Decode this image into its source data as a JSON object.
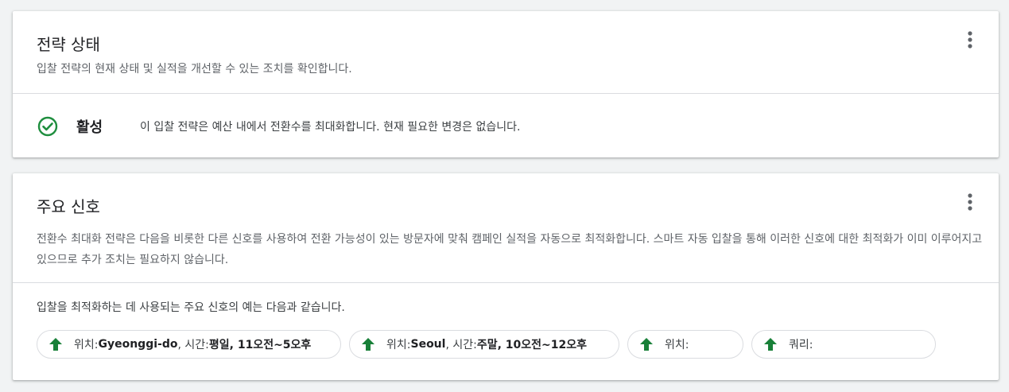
{
  "strategy_status": {
    "title": "전략 상태",
    "description": "입찰 전략의 현재 상태 및 실적을 개선할 수 있는 조치를 확인합니다.",
    "status_label": "활성",
    "status_text": "이 입찰 전략은 예산 내에서 전환수를 최대화합니다. 현재 필요한 변경은 없습니다.",
    "status_color": "#1e8e3e"
  },
  "key_signals": {
    "title": "주요 신호",
    "description": "전환수 최대화 전략은 다음을 비롯한 다른 신호를 사용하여 전환 가능성이 있는 방문자에 맞춰 캠페인 실적을 자동으로 최적화합니다. 스마트 자동 입찰을 통해 이러한 신호에 대한 최적화가 이미 이루어지고 있으므로 추가 조치는 필요하지 않습니다.",
    "intro": "입찰을 최적화하는 데 사용되는 주요 신호의 예는 다음과 같습니다.",
    "arrow_color": "#188038",
    "chips": [
      {
        "location_key": "위치: ",
        "location_value": "Gyeonggi-do",
        "time_key": ", 시간: ",
        "time_value": "평일, 11오전~5오후"
      },
      {
        "location_key": "위치: ",
        "location_value": "Seoul",
        "time_key": ", 시간: ",
        "time_value": "주말, 10오전~12오후"
      },
      {
        "key": "위치:"
      },
      {
        "key": "쿼리:"
      }
    ]
  },
  "icons": {
    "more": "more-vert-icon",
    "status": "check-circle-icon",
    "arrow": "arrow-up-icon"
  }
}
